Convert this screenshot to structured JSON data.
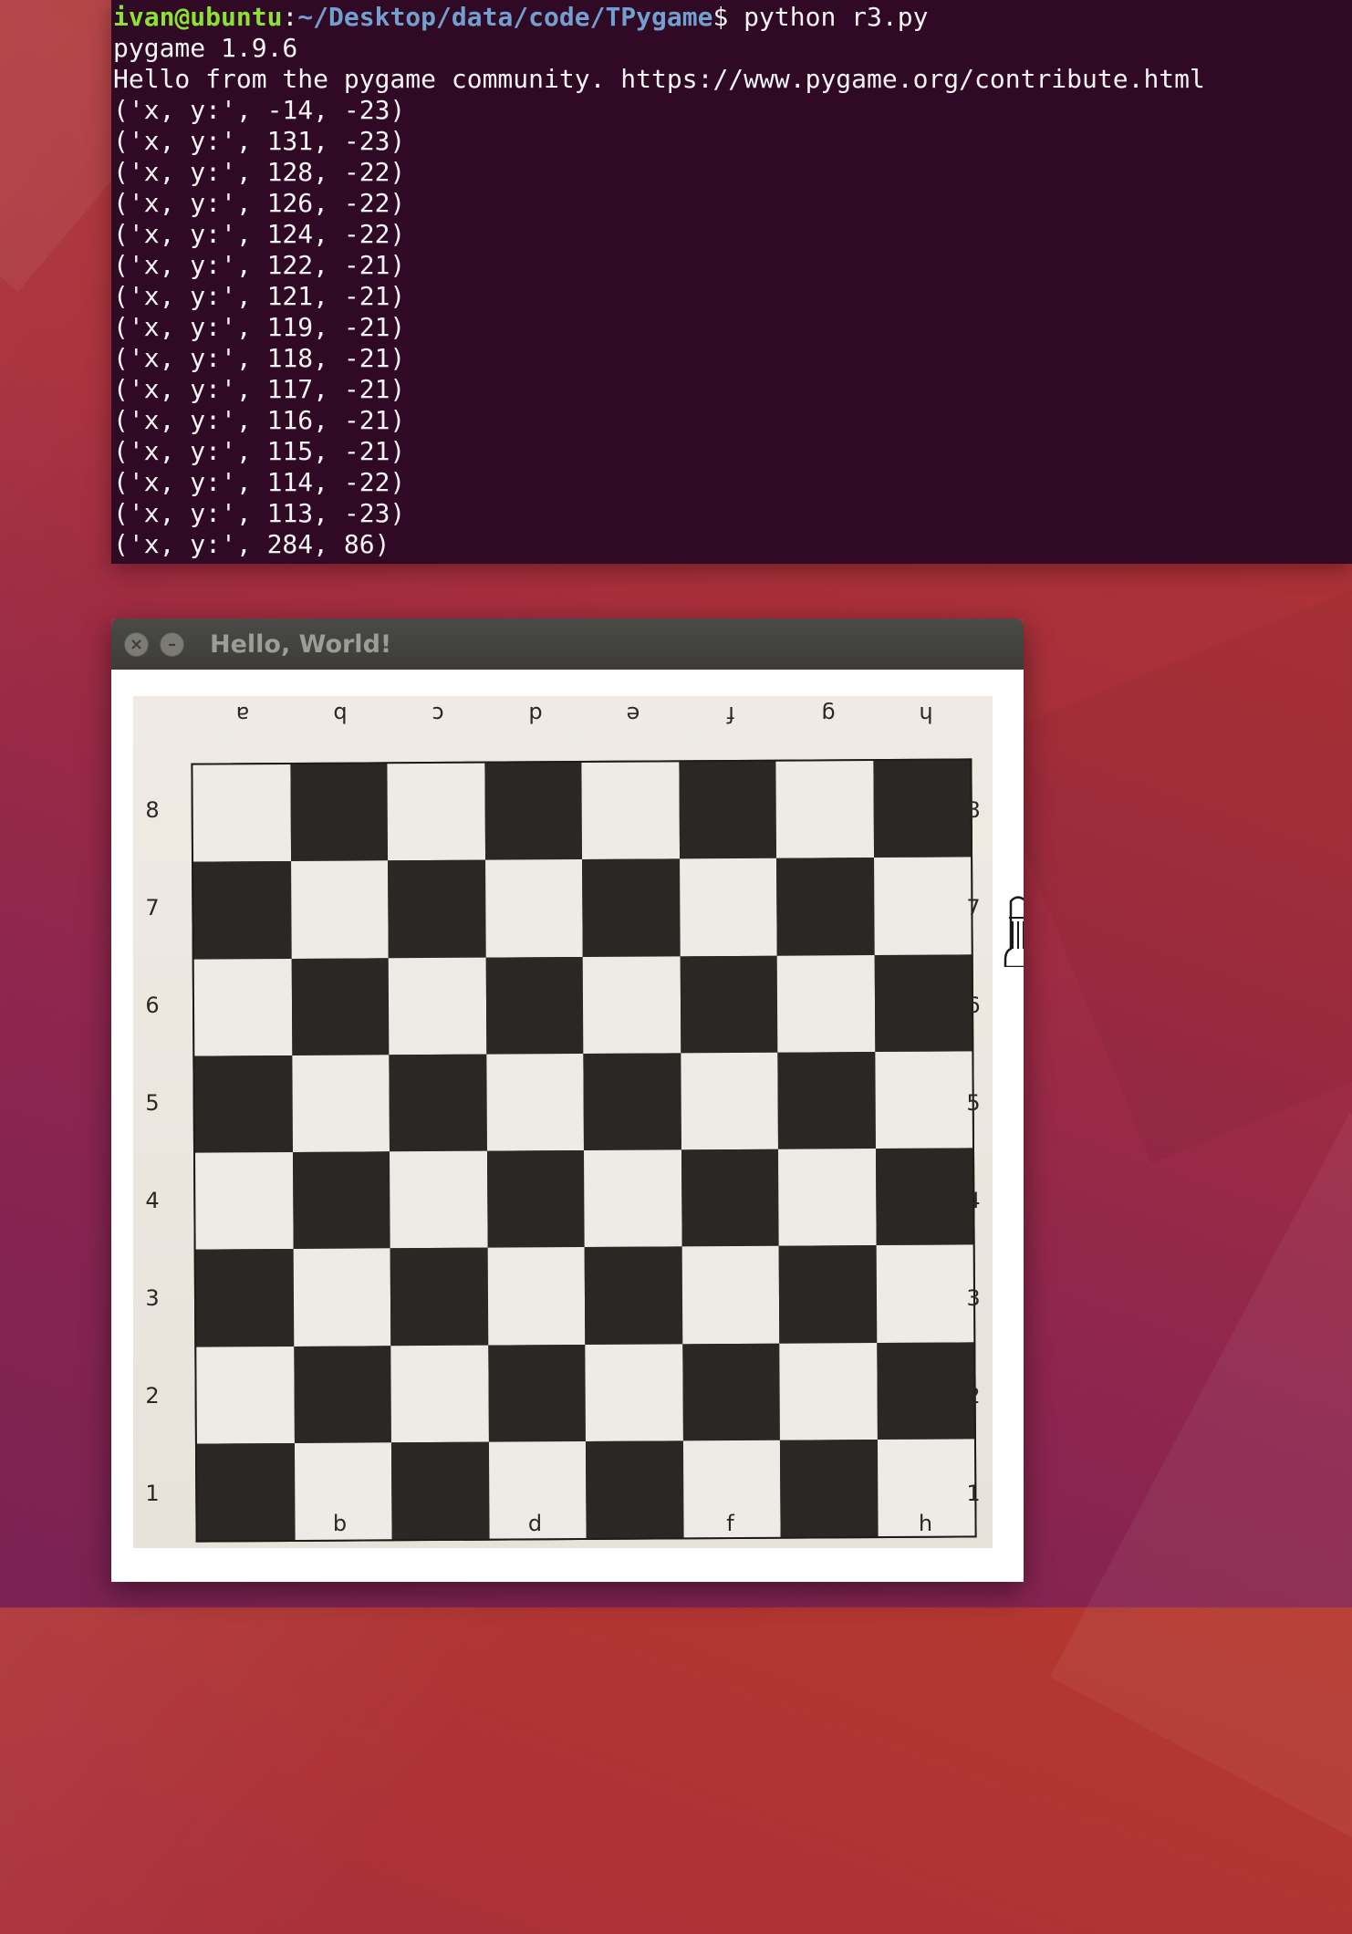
{
  "terminal": {
    "prompt_user": "ivan@ubuntu",
    "prompt_sep": ":",
    "prompt_path": "~/Desktop/data/code/TPygame",
    "prompt_symbol": "$ ",
    "command": "python r3.py",
    "output": [
      "pygame 1.9.6",
      "Hello from the pygame community. https://www.pygame.org/contribute.html",
      "('x, y:', -14, -23)",
      "('x, y:', 131, -23)",
      "('x, y:', 128, -22)",
      "('x, y:', 126, -22)",
      "('x, y:', 124, -22)",
      "('x, y:', 122, -21)",
      "('x, y:', 121, -21)",
      "('x, y:', 119, -21)",
      "('x, y:', 118, -21)",
      "('x, y:', 117, -21)",
      "('x, y:', 116, -21)",
      "('x, y:', 115, -21)",
      "('x, y:', 114, -22)",
      "('x, y:', 113, -23)",
      "('x, y:', 284, 86)"
    ]
  },
  "window": {
    "title": "Hello, World!",
    "close_glyph": "×",
    "minimize_glyph": "–"
  },
  "board": {
    "files": [
      "a",
      "b",
      "c",
      "d",
      "e",
      "f",
      "g",
      "h"
    ],
    "ranks": [
      "8",
      "7",
      "6",
      "5",
      "4",
      "3",
      "2",
      "1"
    ],
    "light_color": "#eeebe6",
    "dark_color": "#2a2724"
  },
  "sprite": {
    "icon": "pawn-icon"
  }
}
